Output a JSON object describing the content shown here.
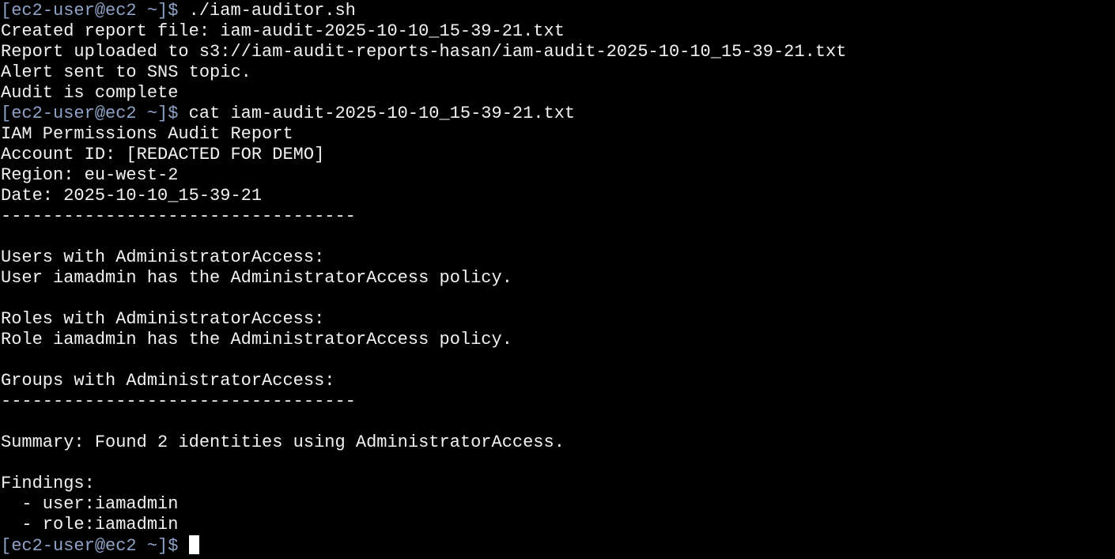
{
  "terminal": {
    "prompt": "[ec2-user@ec2 ~]$",
    "background": "#000000",
    "foreground": "#f2f2f2",
    "prompt_color": "#8fa3c8",
    "commands": [
      " ./iam-auditor.sh",
      " cat iam-audit-2025-10-10_15-39-21.txt"
    ],
    "output_block_1": [
      "Created report file: iam-audit-2025-10-10_15-39-21.txt",
      "Report uploaded to s3://iam-audit-reports-hasan/iam-audit-2025-10-10_15-39-21.txt",
      "Alert sent to SNS topic.",
      "Audit is complete"
    ],
    "output_block_2": [
      "IAM Permissions Audit Report",
      "Account ID: [REDACTED FOR DEMO]",
      "Region: eu-west-2",
      "Date: 2025-10-10_15-39-21",
      "----------------------------------",
      "",
      "Users with AdministratorAccess:",
      "User iamadmin has the AdministratorAccess policy.",
      "",
      "Roles with AdministratorAccess:",
      "Role iamadmin has the AdministratorAccess policy.",
      "",
      "Groups with AdministratorAccess:",
      "----------------------------------",
      "",
      "Summary: Found 2 identities using AdministratorAccess.",
      "",
      "Findings:",
      "  - user:iamadmin",
      "  - role:iamadmin"
    ]
  }
}
